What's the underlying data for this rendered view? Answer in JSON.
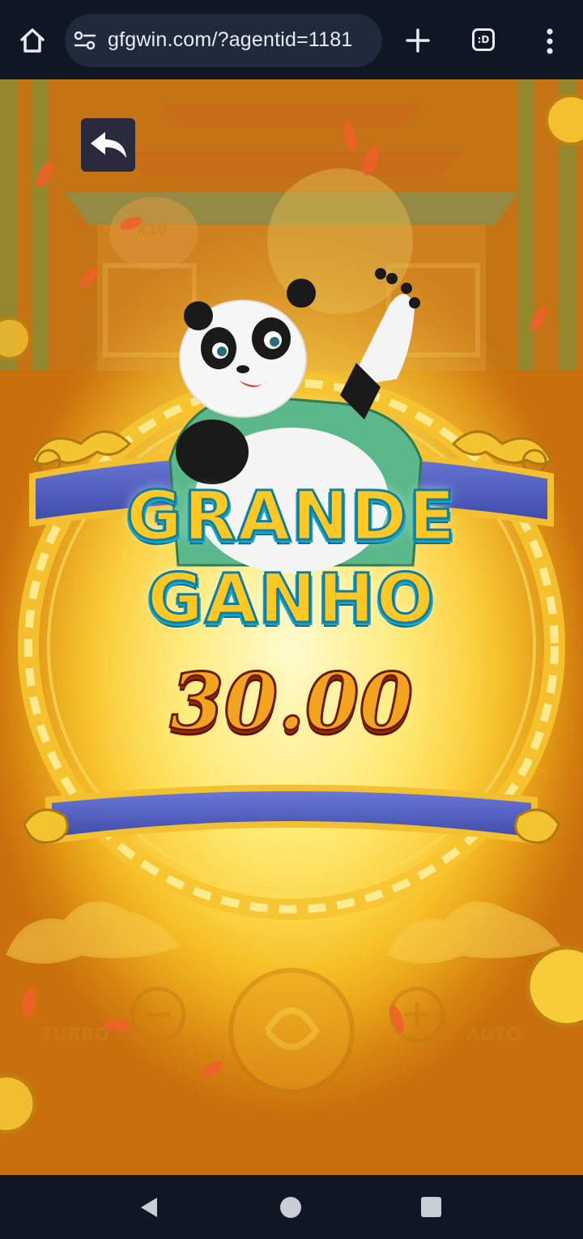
{
  "browser": {
    "url": "gfgwin.com/?agentid=1181",
    "tabs_label": ":D",
    "icons": {
      "home": "home-icon",
      "site_settings": "site-settings-icon",
      "new_tab": "plus-icon",
      "tabs": "tab-switcher-icon",
      "menu": "kebab-menu-icon"
    }
  },
  "game": {
    "back_icon": "back-arrow-icon",
    "big_win_line1": "GRANDE",
    "big_win_line2": "GANHO",
    "win_amount": "30.00",
    "background_labels": {
      "turbo": "TURBO",
      "auto": "AUTO",
      "multiplier_badge": "X10"
    },
    "colors": {
      "title_fill": "#ffc824",
      "title_outline": "#1aa6cc",
      "amount_fill": "#f2a420",
      "amount_outline": "#6a1a08",
      "banner_blue": "#4a58b8",
      "gold": "#f0b820"
    }
  },
  "system_nav": {
    "icons": [
      "back-triangle-icon",
      "home-circle-icon",
      "recents-square-icon"
    ]
  }
}
